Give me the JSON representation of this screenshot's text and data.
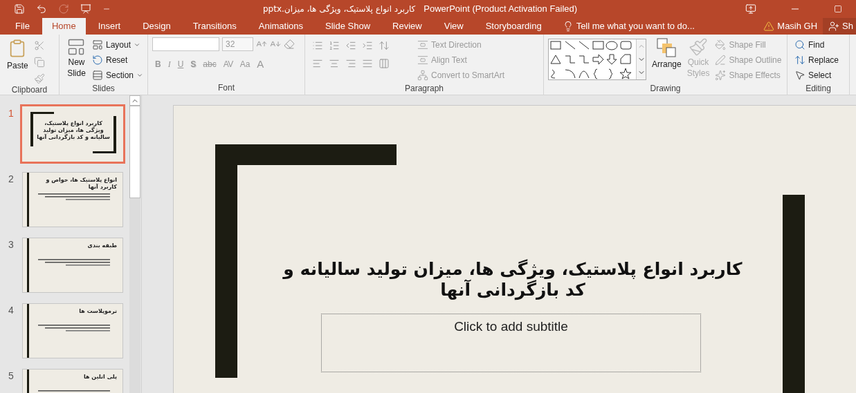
{
  "window": {
    "filename": "کاربرد انواع پلاستیک، ویژگی ها، میزان.pptx",
    "app": "PowerPoint (Product Activation Failed)"
  },
  "tabs": [
    {
      "label": "File",
      "selected": false
    },
    {
      "label": "Home",
      "selected": true
    },
    {
      "label": "Insert",
      "selected": false
    },
    {
      "label": "Design",
      "selected": false
    },
    {
      "label": "Transitions",
      "selected": false
    },
    {
      "label": "Animations",
      "selected": false
    },
    {
      "label": "Slide Show",
      "selected": false
    },
    {
      "label": "Review",
      "selected": false
    },
    {
      "label": "View",
      "selected": false
    },
    {
      "label": "Storyboarding",
      "selected": false
    }
  ],
  "tell_me": {
    "placeholder": "Tell me what you want to do..."
  },
  "user": {
    "name": "Masih GH"
  },
  "share": {
    "label": "Sh"
  },
  "ribbon": {
    "clipboard": {
      "label": "Clipboard",
      "paste": "Paste"
    },
    "slides": {
      "label": "Slides",
      "new_slide": "New Slide",
      "commands": [
        {
          "label": "Layout",
          "dropdown": true
        },
        {
          "label": "Reset",
          "dropdown": false
        },
        {
          "label": "Section",
          "dropdown": true
        }
      ]
    },
    "font": {
      "label": "Font",
      "size": "32",
      "buttons": [
        {
          "label": "B",
          "kind": "bold"
        },
        {
          "label": "I",
          "kind": "italic"
        },
        {
          "label": "U",
          "kind": "underline"
        },
        {
          "label": "S",
          "kind": "shadow"
        },
        {
          "label": "abc",
          "kind": "strike"
        },
        {
          "label": "AV",
          "kind": "spacing"
        },
        {
          "label": "Aa",
          "kind": "case"
        },
        {
          "label": "A",
          "kind": "color"
        }
      ]
    },
    "paragraph": {
      "label": "Paragraph",
      "commands": [
        {
          "label": "Text Direction",
          "disabled": true
        },
        {
          "label": "Align Text",
          "disabled": true
        },
        {
          "label": "Convert to SmartArt",
          "disabled": true
        }
      ]
    },
    "drawing": {
      "label": "Drawing",
      "arrange": "Arrange",
      "quick_styles": "Quick Styles",
      "commands": [
        {
          "label": "Shape Fill",
          "disabled": true
        },
        {
          "label": "Shape Outline",
          "disabled": true
        },
        {
          "label": "Shape Effects",
          "disabled": true
        }
      ]
    },
    "editing": {
      "label": "Editing",
      "commands": [
        {
          "label": "Find",
          "disabled": false
        },
        {
          "label": "Replace",
          "disabled": false
        },
        {
          "label": "Select",
          "disabled": false
        }
      ]
    }
  },
  "slides": [
    {
      "number": "1",
      "selected": true,
      "kind": "title",
      "title": "کاربرد انواع پلاستیک، ویژگی ها، میزان تولید سالیانه و کد بازگردانی آنها"
    },
    {
      "number": "2",
      "selected": false,
      "kind": "content",
      "title": "انواع پلاستیک ها، خواص و کاربرد آنها"
    },
    {
      "number": "3",
      "selected": false,
      "kind": "content",
      "title": "طبقه بندی"
    },
    {
      "number": "4",
      "selected": false,
      "kind": "content",
      "title": "ترموپلاست ها"
    },
    {
      "number": "5",
      "selected": false,
      "kind": "content",
      "title": "پلی اتلین ها"
    }
  ],
  "canvas": {
    "title": "کاربرد انواع پلاستیک، ویژگی ها، میزان تولید سالیانه و کد بازگردانی آنها",
    "subtitle_placeholder": "Click to add subtitle"
  }
}
